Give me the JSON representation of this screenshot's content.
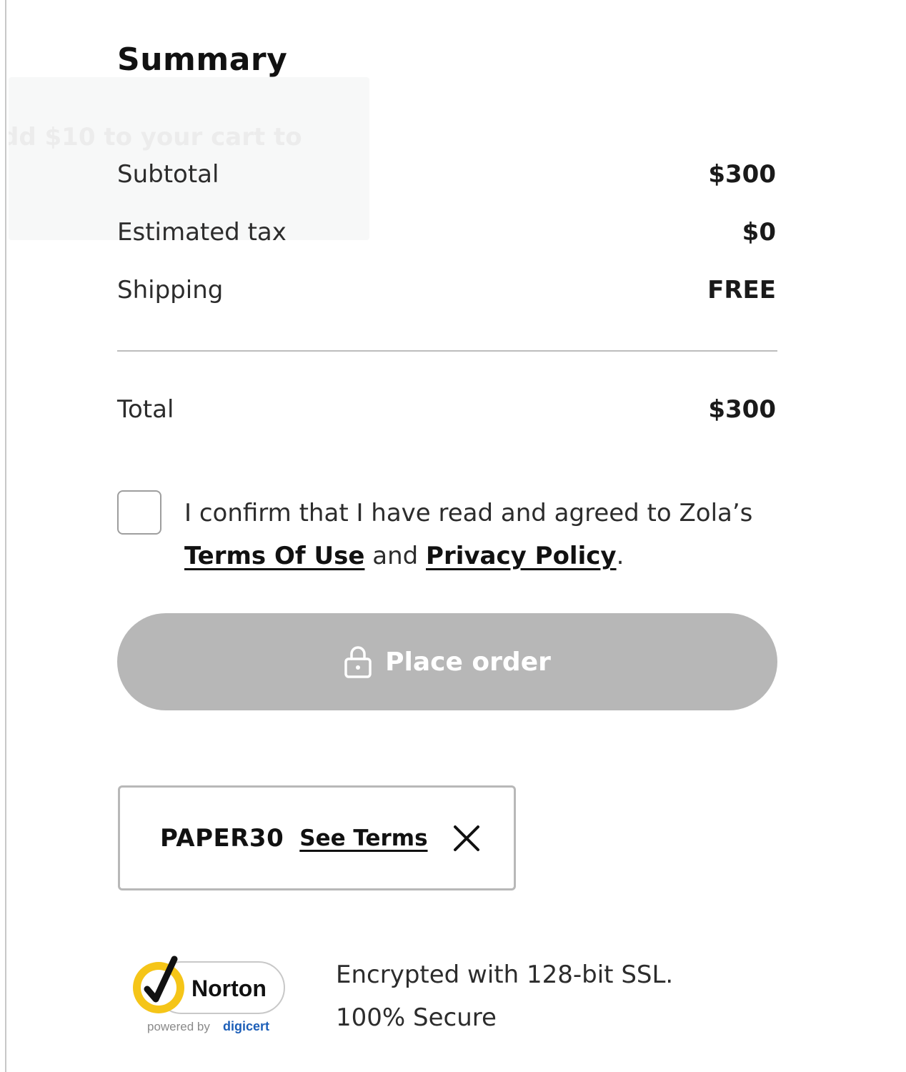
{
  "summary": {
    "title": "Summary",
    "promo_ghost_text": "dd $10 to your cart to",
    "rows": [
      {
        "label": "Subtotal",
        "value": "$300"
      },
      {
        "label": "Estimated tax",
        "value": "$0"
      },
      {
        "label": "Shipping",
        "value": "FREE"
      }
    ],
    "total": {
      "label": "Total",
      "value": "$300"
    }
  },
  "confirm": {
    "checked": false,
    "text_before": "I confirm that I have read and agreed to Zola’s ",
    "terms_link": "Terms Of Use",
    "text_middle": " and ",
    "privacy_link": "Privacy Policy",
    "text_after": "."
  },
  "place_order": {
    "label": "Place order",
    "icon": "lock-icon",
    "disabled_color": "#b7b7b7"
  },
  "promo": {
    "code": "PAPER30",
    "see_terms_label": "See Terms",
    "remove_icon": "close-icon"
  },
  "security": {
    "badge_brand": "Norton",
    "badge_sub_prefix": "powered by",
    "badge_sub_brand": "digicert",
    "line1": "Encrypted with 128-bit SSL.",
    "line2": "100% Secure"
  },
  "colors": {
    "norton_yellow": "#f5c518",
    "digicert_blue": "#1d5fb8"
  }
}
